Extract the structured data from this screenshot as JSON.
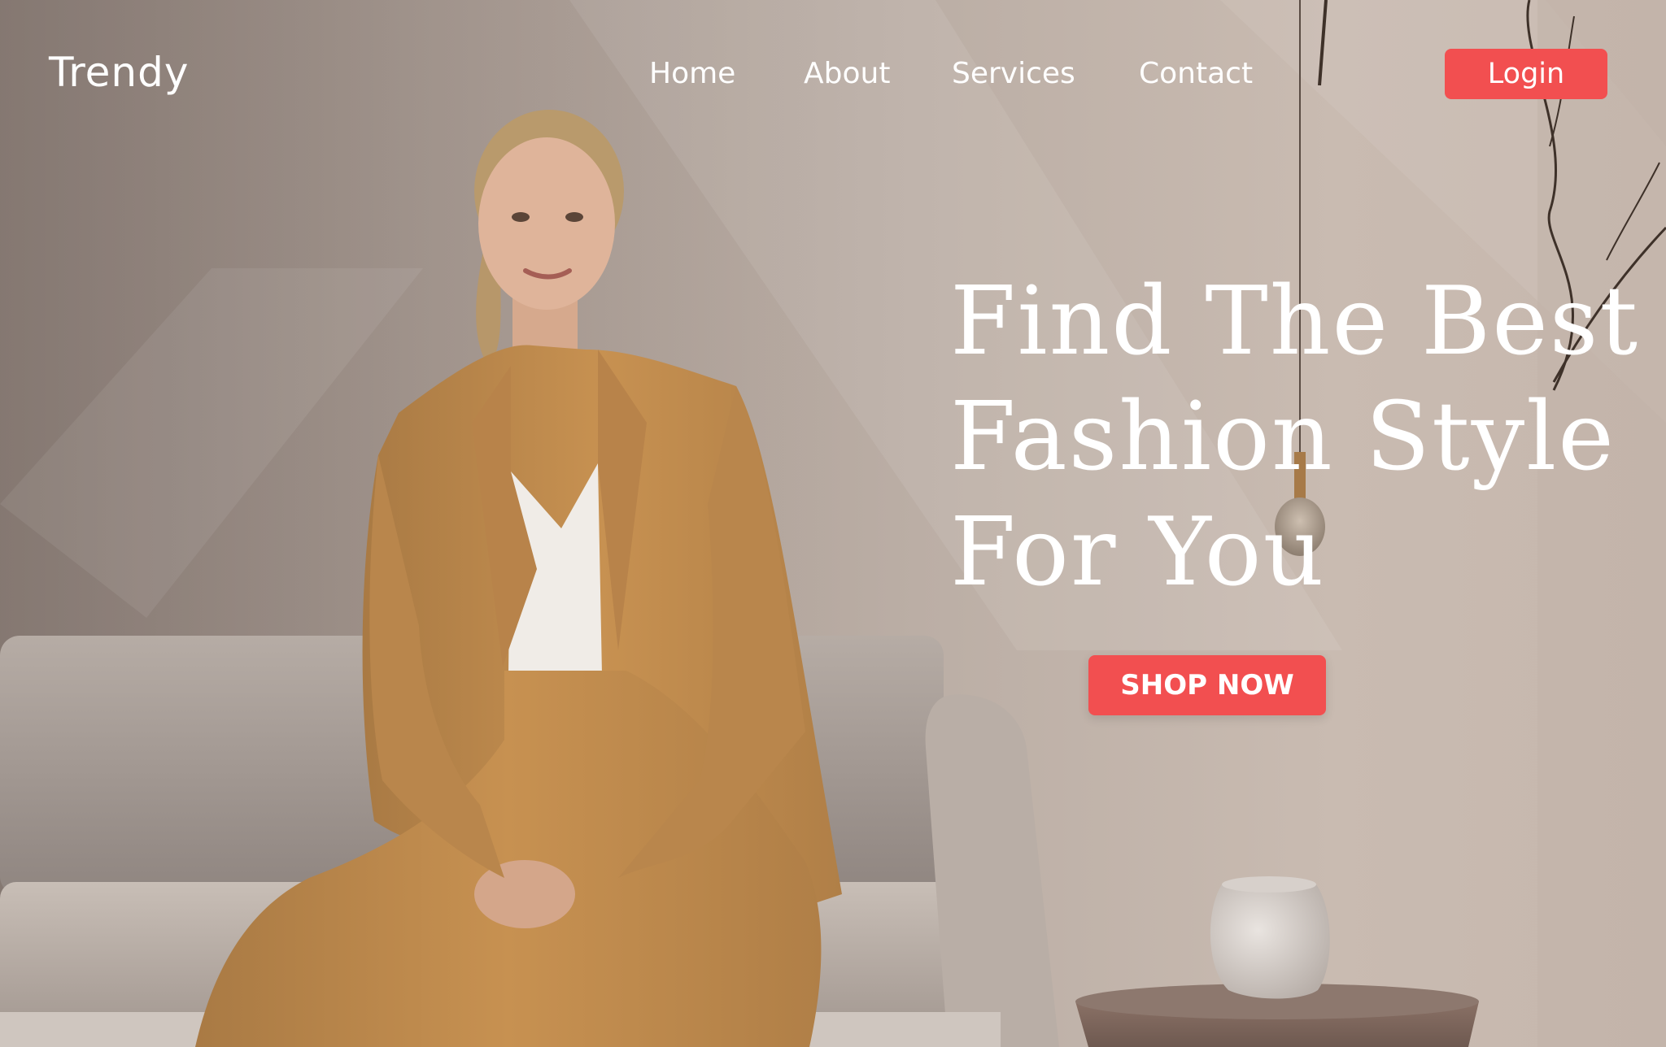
{
  "nav": {
    "brand": "Trendy",
    "links": [
      {
        "label": "Home"
      },
      {
        "label": "About"
      },
      {
        "label": "Services"
      },
      {
        "label": "Contact"
      }
    ],
    "login_label": "Login"
  },
  "hero": {
    "headline_lines": [
      "Find The Best",
      "Fashion Style",
      "For You"
    ],
    "cta_label": "SHOP NOW"
  },
  "colors": {
    "accent": "#f24f50",
    "text": "#ffffff",
    "suit": "#c79151"
  }
}
